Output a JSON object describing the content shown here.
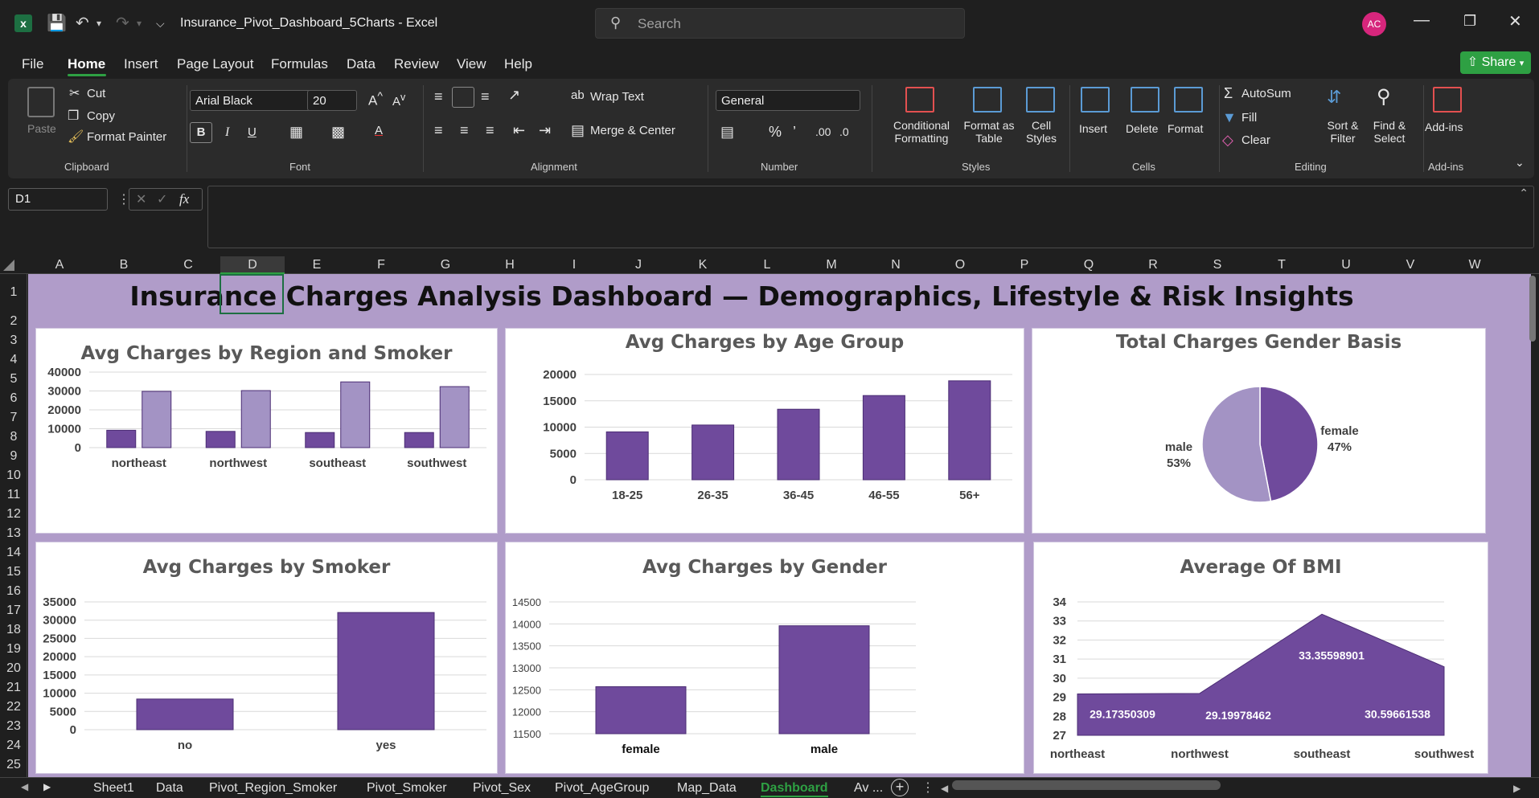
{
  "app": {
    "doc_title": "Insurance_Pivot_Dashboard_5Charts  -  Excel",
    "search_placeholder": "Search",
    "avatar_initials": "AC",
    "share_label": "Share"
  },
  "menu": [
    "File",
    "Home",
    "Insert",
    "Page Layout",
    "Formulas",
    "Data",
    "Review",
    "View",
    "Help"
  ],
  "ribbon": {
    "clipboard": {
      "paste": "Paste",
      "cut": "Cut",
      "copy": "Copy",
      "format_painter": "Format Painter",
      "group": "Clipboard"
    },
    "font": {
      "family": "Arial Black",
      "size": "20",
      "group": "Font"
    },
    "alignment": {
      "wrap": "Wrap Text",
      "merge": "Merge & Center",
      "group": "Alignment"
    },
    "number": {
      "format": "General",
      "group": "Number"
    },
    "styles": {
      "cond1": "Conditional",
      "cond2": "Formatting",
      "fmt1": "Format as",
      "fmt2": "Table",
      "cell1": "Cell",
      "cell2": "Styles",
      "group": "Styles"
    },
    "cells": {
      "insert": "Insert",
      "delete": "Delete",
      "format": "Format",
      "group": "Cells"
    },
    "editing": {
      "autosum": "AutoSum",
      "fill": "Fill",
      "clear": "Clear",
      "sort1": "Sort &",
      "sort2": "Filter",
      "find1": "Find &",
      "find2": "Select",
      "group": "Editing"
    },
    "addins": {
      "label": "Add-ins",
      "group": "Add-ins"
    }
  },
  "formula_bar": {
    "name_box": "D1",
    "fx": "fx"
  },
  "columns": [
    "A",
    "B",
    "C",
    "D",
    "E",
    "F",
    "G",
    "H",
    "I",
    "J",
    "K",
    "L",
    "M",
    "N",
    "O",
    "P",
    "Q",
    "R",
    "S",
    "T",
    "U",
    "V",
    "W"
  ],
  "rows": [
    "1",
    "2",
    "3",
    "4",
    "5",
    "6",
    "7",
    "8",
    "9",
    "10",
    "11",
    "12",
    "13",
    "14",
    "15",
    "16",
    "17",
    "18",
    "19",
    "20",
    "21",
    "22",
    "23",
    "24",
    "25"
  ],
  "dashboard_title": "Insurance Charges Analysis Dashboard — Demographics, Lifestyle & Risk Insights",
  "sheet_tabs": [
    "Sheet1",
    "Data",
    "Pivot_Region_Smoker",
    "Pivot_Smoker",
    "Pivot_Sex",
    "Pivot_AgeGroup",
    "Map_Data",
    "Dashboard",
    "Av ..."
  ],
  "colors": {
    "purple_dark": "#6f4a9c",
    "purple_light": "#a393c4",
    "bg": "#b09cc9",
    "green": "#2ea043"
  },
  "chart_data": [
    {
      "id": "region_smoker",
      "type": "bar",
      "title": "Avg Charges by Region and Smoker",
      "categories": [
        "northeast",
        "northwest",
        "southeast",
        "southwest"
      ],
      "series": [
        {
          "values": [
            9200,
            8600,
            8000,
            8000
          ]
        },
        {
          "values": [
            29800,
            30200,
            34800,
            32300
          ]
        }
      ],
      "yticks": [
        "40000",
        "30000",
        "20000",
        "10000",
        "0"
      ],
      "ylim": [
        0,
        40000
      ]
    },
    {
      "id": "age_group",
      "type": "bar",
      "title": "Avg Charges by Age Group",
      "categories": [
        "18-25",
        "26-35",
        "36-45",
        "46-55",
        "56+"
      ],
      "values": [
        9100,
        10400,
        13400,
        16000,
        18800
      ],
      "yticks": [
        "20000",
        "15000",
        "10000",
        "5000",
        "0"
      ],
      "ylim": [
        0,
        20000
      ]
    },
    {
      "id": "gender_total",
      "type": "pie",
      "title": "Total Charges Gender Basis",
      "slices": [
        {
          "label": "female",
          "pct": "47%",
          "value": 47
        },
        {
          "label": "male",
          "pct": "53%",
          "value": 53
        }
      ]
    },
    {
      "id": "smoker",
      "type": "bar",
      "title": "Avg Charges by Smoker",
      "categories": [
        "no",
        "yes"
      ],
      "values": [
        8400,
        32100
      ],
      "yticks": [
        "35000",
        "30000",
        "25000",
        "20000",
        "15000",
        "10000",
        "5000",
        "0"
      ],
      "ylim": [
        0,
        35000
      ]
    },
    {
      "id": "gender_avg",
      "type": "bar",
      "title": "Avg Charges by Gender",
      "categories": [
        "female",
        "male"
      ],
      "values": [
        12570,
        13957
      ],
      "yticks": [
        "14500",
        "14000",
        "13500",
        "13000",
        "12500",
        "12000",
        "11500"
      ],
      "ylim": [
        11500,
        14500
      ]
    },
    {
      "id": "bmi",
      "type": "area",
      "title": "Average Of BMI",
      "categories": [
        "northeast",
        "northwest",
        "southeast",
        "southwest"
      ],
      "values": [
        29.17350309,
        29.19978462,
        33.35598901,
        30.59661538
      ],
      "labels": [
        "29.17350309",
        "29.19978462",
        "33.35598901",
        "30.59661538"
      ],
      "yticks": [
        "34",
        "33",
        "32",
        "31",
        "30",
        "29",
        "28",
        "27"
      ],
      "ylim": [
        27,
        34
      ]
    }
  ]
}
